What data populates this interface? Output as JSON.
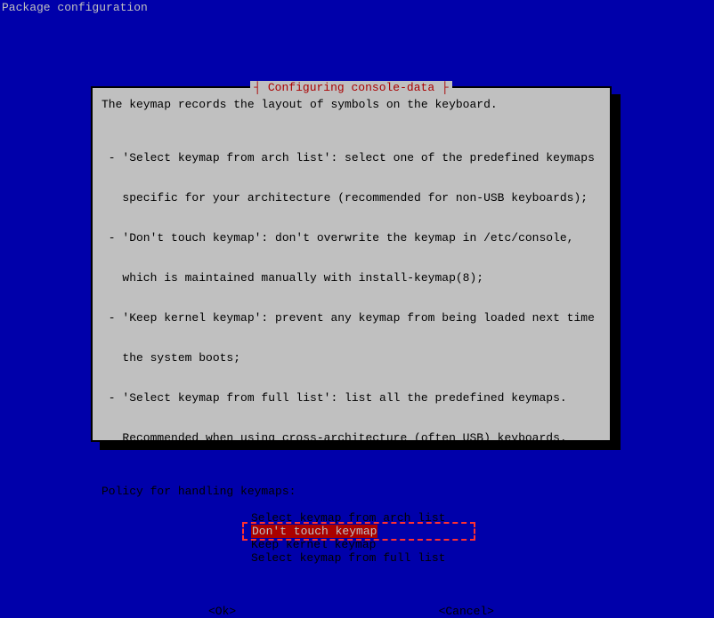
{
  "header": "Package configuration",
  "dialog": {
    "title": "┤ Configuring console-data ├",
    "intro": "The keymap records the layout of symbols on the keyboard.",
    "items": [
      " - 'Select keymap from arch list': select one of the predefined keymaps",
      "   specific for your architecture (recommended for non-USB keyboards);",
      " - 'Don't touch keymap': don't overwrite the keymap in /etc/console,",
      "   which is maintained manually with install-keymap(8);",
      " - 'Keep kernel keymap': prevent any keymap from being loaded next time",
      "   the system boots;",
      " - 'Select keymap from full list': list all the predefined keymaps.",
      "   Recommended when using cross-architecture (often USB) keyboards."
    ],
    "prompt": "Policy for handling keymaps:",
    "options": [
      "Select keymap from arch list",
      "Don't touch keymap",
      "Keep kernel keymap",
      "Select keymap from full list"
    ],
    "selected_index": 1,
    "buttons": {
      "ok": "<Ok>",
      "cancel": "<Cancel>"
    }
  }
}
